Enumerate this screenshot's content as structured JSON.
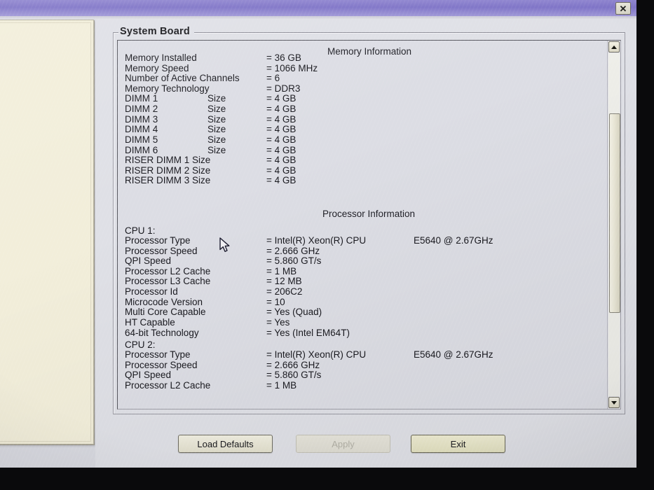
{
  "window": {
    "titlebar_color": "#8e84cf",
    "close_icon": "✕"
  },
  "groupbox": {
    "legend": "System Board"
  },
  "memory": {
    "heading": "Memory Information",
    "rows": [
      {
        "label": "Memory Installed",
        "sub": "",
        "value": "= 36 GB"
      },
      {
        "label": "Memory Speed",
        "sub": "",
        "value": "= 1066 MHz"
      },
      {
        "label": "Number of Active Channels",
        "sub": "",
        "value": "= 6"
      },
      {
        "label": "Memory Technology",
        "sub": "",
        "value": "= DDR3"
      },
      {
        "label": "DIMM 1",
        "sub": "Size",
        "value": "= 4 GB"
      },
      {
        "label": "DIMM 2",
        "sub": "Size",
        "value": "= 4 GB"
      },
      {
        "label": "DIMM 3",
        "sub": "Size",
        "value": "= 4 GB"
      },
      {
        "label": "DIMM 4",
        "sub": "Size",
        "value": "= 4 GB"
      },
      {
        "label": "DIMM 5",
        "sub": "Size",
        "value": "= 4 GB"
      },
      {
        "label": "DIMM 6",
        "sub": "Size",
        "value": "= 4 GB"
      },
      {
        "label": "RISER DIMM 1 Size",
        "sub": "",
        "value": "= 4 GB"
      },
      {
        "label": "RISER DIMM 2 Size",
        "sub": "",
        "value": "= 4 GB"
      },
      {
        "label": "RISER DIMM 3 Size",
        "sub": "",
        "value": "= 4 GB"
      }
    ]
  },
  "processor": {
    "heading": "Processor Information",
    "cpu1": {
      "title": "CPU 1:",
      "rows": [
        {
          "label": "Processor Type",
          "value": "= Intel(R) Xeon(R) CPU",
          "value2": "E5640  @ 2.67GHz"
        },
        {
          "label": "Processor Speed",
          "value": "= 2.666 GHz",
          "value2": ""
        },
        {
          "label": "QPI Speed",
          "value": "= 5.860 GT/s",
          "value2": ""
        },
        {
          "label": "Processor L2 Cache",
          "value": "= 1 MB",
          "value2": ""
        },
        {
          "label": "Processor L3 Cache",
          "value": "= 12 MB",
          "value2": ""
        },
        {
          "label": "Processor Id",
          "value": "= 206C2",
          "value2": ""
        },
        {
          "label": "Microcode Version",
          "value": "= 10",
          "value2": ""
        },
        {
          "label": "Multi Core Capable",
          "value": "= Yes (Quad)",
          "value2": ""
        },
        {
          "label": "HT Capable",
          "value": "= Yes",
          "value2": ""
        },
        {
          "label": "64-bit Technology",
          "value": "= Yes (Intel EM64T)",
          "value2": ""
        }
      ]
    },
    "cpu2": {
      "title": "CPU 2:",
      "rows": [
        {
          "label": "Processor Type",
          "value": "= Intel(R) Xeon(R) CPU",
          "value2": "E5640  @ 2.67GHz"
        },
        {
          "label": "Processor Speed",
          "value": "= 2.666 GHz",
          "value2": ""
        },
        {
          "label": "QPI Speed",
          "value": "= 5.860 GT/s",
          "value2": ""
        },
        {
          "label": "Processor L2 Cache",
          "value": "= 1 MB",
          "value2": ""
        }
      ]
    }
  },
  "scrollbar": {
    "up_arrow": "▲",
    "down_arrow": "▼"
  },
  "buttons": {
    "load_defaults": "Load Defaults",
    "apply": "Apply",
    "exit": "Exit"
  }
}
